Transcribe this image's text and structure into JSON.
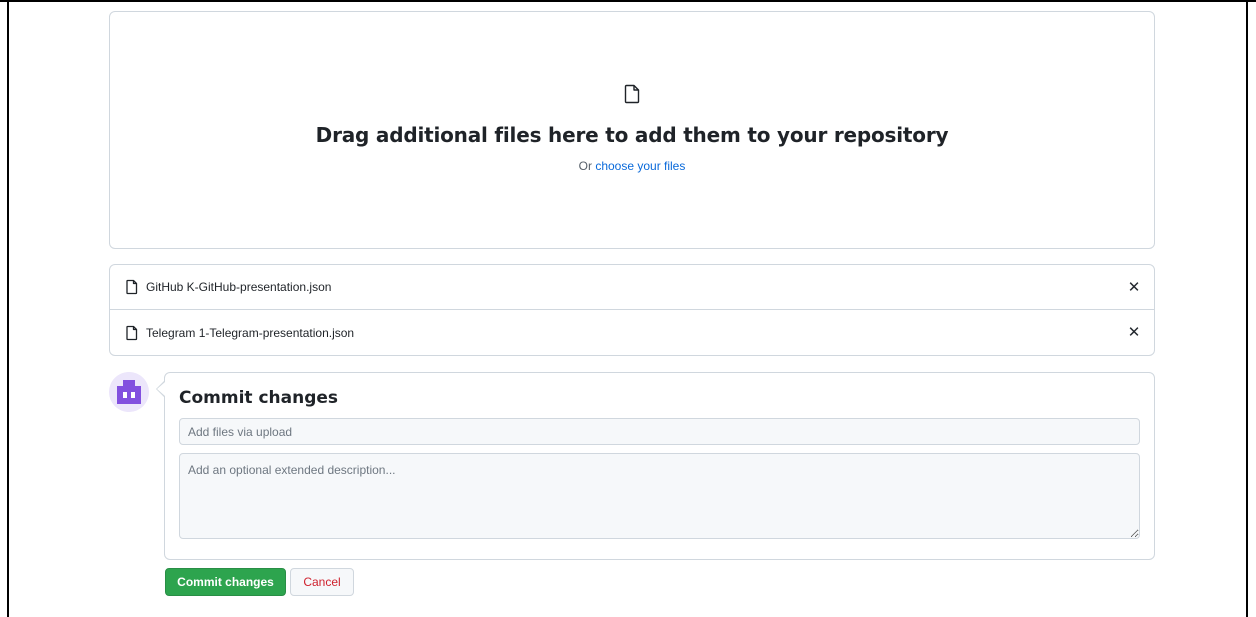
{
  "dropzone": {
    "title": "Drag additional files here to add them to your repository",
    "prefix": "Or ",
    "link": "choose your files"
  },
  "files": [
    {
      "name": "GitHub K-GitHub-presentation.json",
      "remove_icon": "x-icon"
    },
    {
      "name": "Telegram 1-Telegram-presentation.json",
      "remove_icon": "x-icon"
    }
  ],
  "commit": {
    "title": "Commit changes",
    "summary_placeholder": "Add files via upload",
    "summary_value": "",
    "description_placeholder": "Add an optional extended description...",
    "description_value": "",
    "submit_label": "Commit changes",
    "cancel_label": "Cancel"
  },
  "colors": {
    "primary_button": "#2da44e",
    "link": "#0969da",
    "cancel_text": "#cf222e",
    "avatar": "#8250df"
  }
}
